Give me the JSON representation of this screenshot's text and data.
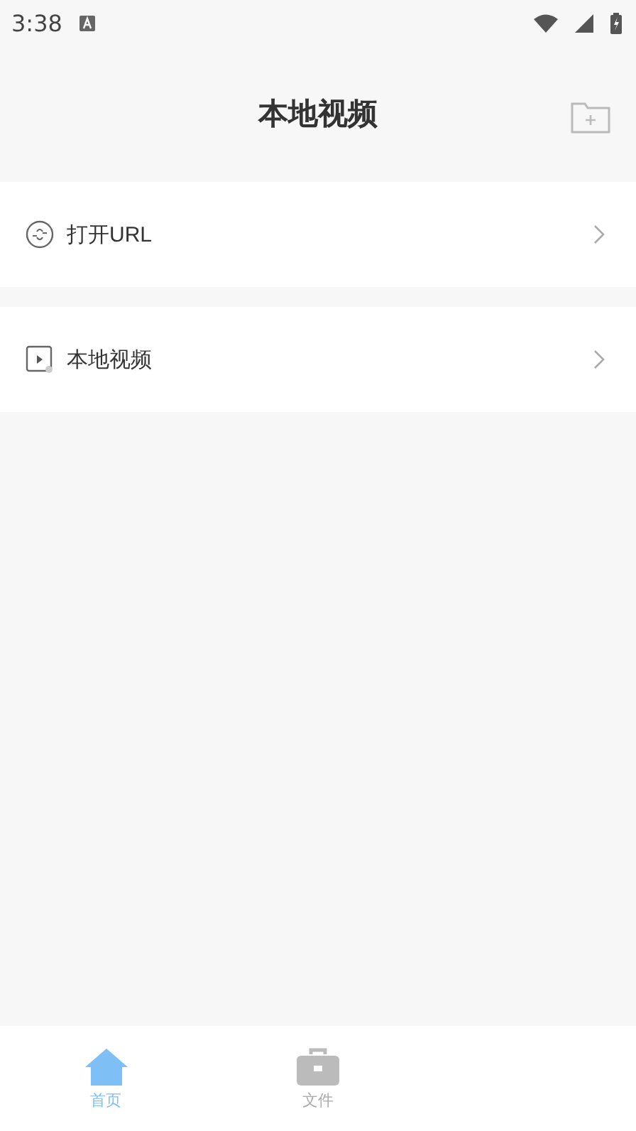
{
  "status_bar": {
    "time": "3:38"
  },
  "header": {
    "title": "本地视频"
  },
  "menu": [
    {
      "kind": "link",
      "label": "打开URL"
    },
    {
      "kind": "video",
      "label": "本地视频"
    }
  ],
  "tab_bar": [
    {
      "kind": "home",
      "label": "首页",
      "selected": true
    },
    {
      "kind": "files",
      "label": "文件",
      "selected": false
    }
  ]
}
